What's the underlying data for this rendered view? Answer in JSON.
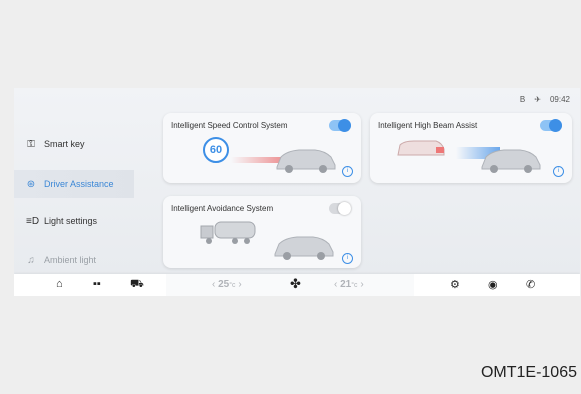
{
  "status": {
    "icon1": "B",
    "icon2": "✈",
    "time": "09:42"
  },
  "sidebar": {
    "items": [
      {
        "label": "Smart key",
        "icon": "key-icon",
        "glyph": "⚿"
      },
      {
        "label": "Driver Assistance",
        "icon": "steering-icon",
        "glyph": "⊛"
      },
      {
        "label": "Light settings",
        "icon": "headlight-icon",
        "glyph": "≡D"
      },
      {
        "label": "Ambient light",
        "icon": "ambient-icon",
        "glyph": "♫"
      }
    ]
  },
  "cards": {
    "speed": {
      "title": "Intelligent Speed Control System",
      "enabled": true,
      "speed_sign": "60"
    },
    "highbeam": {
      "title": "Intelligent High Beam Assist",
      "enabled": true
    },
    "avoid": {
      "title": "Intelligent Avoidance System",
      "enabled": false
    }
  },
  "dock": {
    "left_temp": {
      "value": "25",
      "unit": "°c",
      "prev": "‹",
      "next": "›"
    },
    "right_temp": {
      "value": "21",
      "unit": "°c",
      "prev": "‹",
      "next": "›"
    },
    "icons": [
      "home-icon",
      "apps-icon",
      "car-icon",
      "fan-icon",
      "settings-icon",
      "media-icon",
      "phone-icon"
    ]
  },
  "code": "OMT1E-1065"
}
